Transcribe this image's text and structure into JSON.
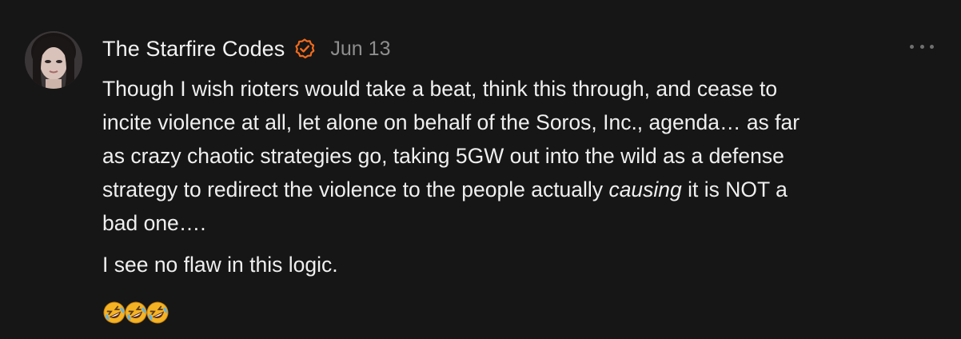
{
  "post": {
    "author": "The Starfire Codes",
    "date": "Jun 13",
    "paragraph1": {
      "line1": "Though I wish rioters would take a beat, think this through, and cease to",
      "line2": "incite violence at all, let alone on behalf of the Soros, Inc., agenda… as far",
      "line3": "as crazy chaotic strategies go, taking 5GW out into the wild as a defense",
      "line4_before": "strategy to redirect the violence to the people actually ",
      "line4_em": "causing",
      "line4_after": " it is NOT a",
      "line5": "bad one…."
    },
    "paragraph2": "I see no flaw in this logic.",
    "reactions": [
      "rolling-on-floor-laughing-emoji",
      "rolling-on-floor-laughing-emoji",
      "rolling-on-floor-laughing-emoji"
    ]
  },
  "colors": {
    "background": "#161616",
    "text": "#efefef",
    "muted": "#8e8e8e",
    "verified_accent": "#f26b1d",
    "emoji_yellow": "#f5b324"
  },
  "icons": {
    "verified": "verified-check-icon",
    "more": "more-horizontal-icon"
  }
}
